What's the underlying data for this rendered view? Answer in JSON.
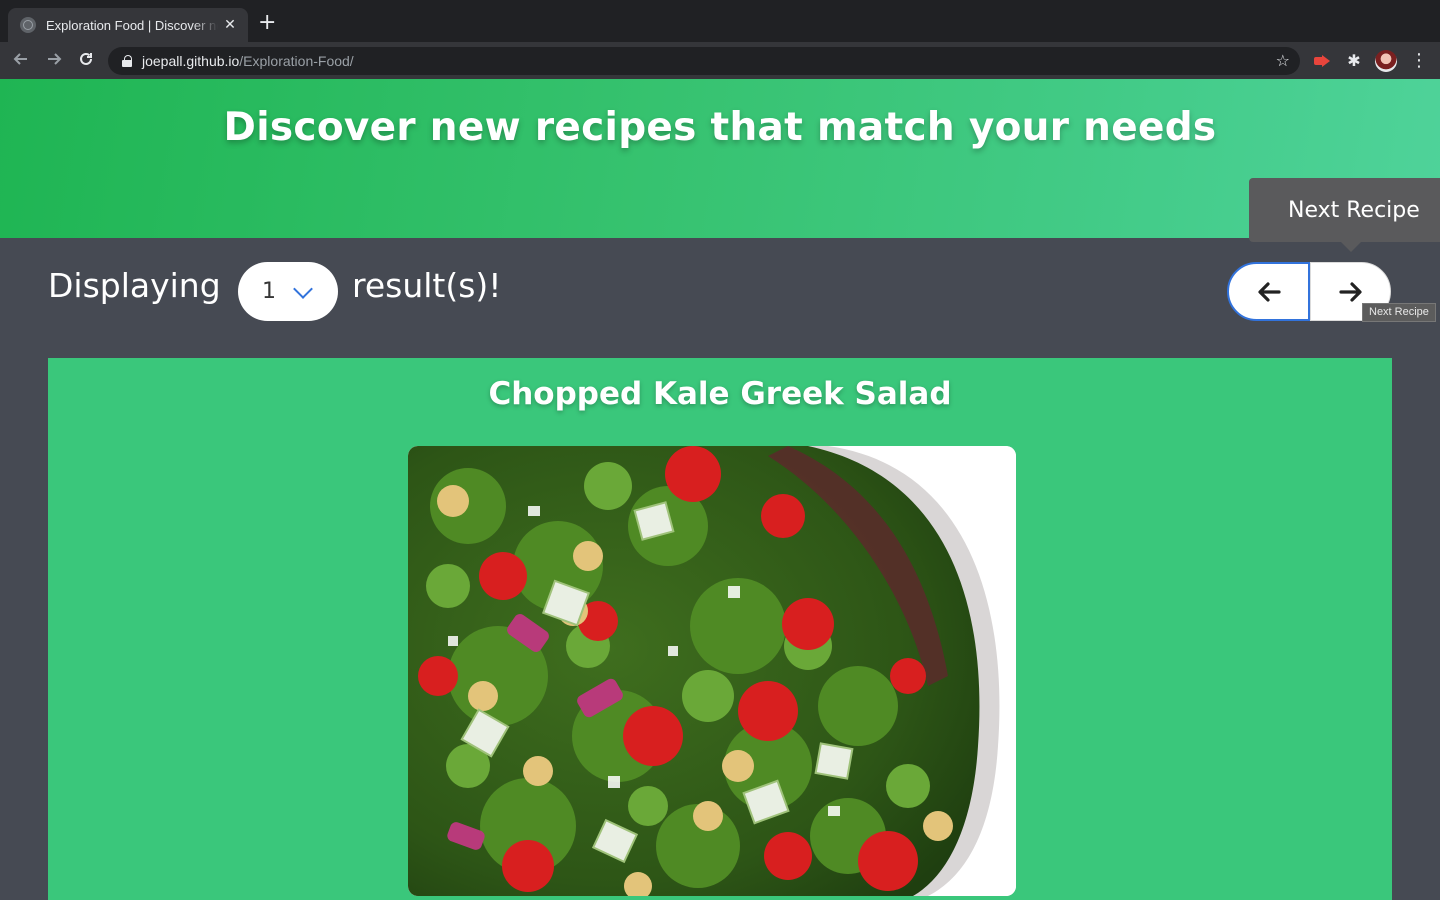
{
  "browser": {
    "tab_title": "Exploration Food | Discover new recipes",
    "tab_close": "✕",
    "new_tab": "+",
    "url_host": "joepall.github.io",
    "url_path": "/Exploration-Food/",
    "back_icon": "arrow-left-icon",
    "forward_icon": "arrow-right-icon",
    "reload_icon": "reload-icon"
  },
  "hero": {
    "title": "Discover new recipes that match your needs"
  },
  "controls": {
    "displaying_label": "Displaying",
    "result_count": "1",
    "results_label": "result(s)!",
    "prev_arrow": "🡐",
    "next_arrow": "🡒",
    "next_tooltip": "Next Recipe",
    "next_tooltip_native": "Next Recipe"
  },
  "recipe": {
    "title": "Chopped Kale Greek Salad",
    "image_subject": "salad-photo"
  },
  "colors": {
    "hero_start": "#1fb553",
    "hero_end": "#4fd39a",
    "card": "#3ac77b",
    "page_bg": "#464a53",
    "accent_blue": "#3273dc"
  }
}
